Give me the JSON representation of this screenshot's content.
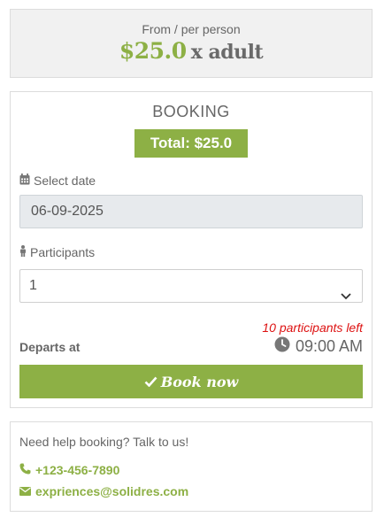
{
  "price": {
    "from_label": "From / per person",
    "amount": "$25.0",
    "unit": "x adult"
  },
  "booking": {
    "title": "BOOKING",
    "total": "Total: $25.0",
    "date_label": "Select date",
    "date_value": "06-09-2025",
    "participants_label": "Participants",
    "participants_value": "1",
    "participants_left": "10 participants left",
    "departs_label": "Departs at",
    "departs_time": "09:00 AM",
    "book_button": "Book now"
  },
  "help": {
    "text": "Need help booking? Talk to us!",
    "phone": "+123-456-7890",
    "email": "expriences@solidres.com"
  },
  "icons": {
    "date": "calendar-icon",
    "participants": "person-icon",
    "select": "chevron-down-icon",
    "time": "clock-icon",
    "book": "check-icon",
    "phone": "phone-icon",
    "email": "envelope-icon"
  },
  "colors": {
    "accent": "#8db045",
    "warning": "#dd1111",
    "panel": "#f1f1f1",
    "input_disabled": "#e7eaed"
  }
}
